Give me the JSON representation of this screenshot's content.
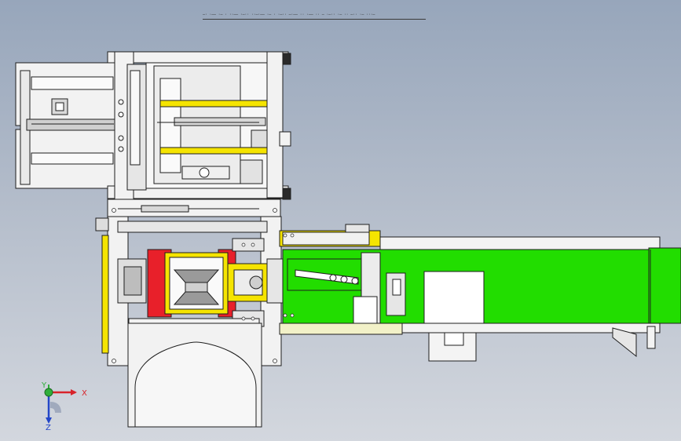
{
  "viewport": {
    "title_text": "—· ·—— ·— · ··—— ·—·· ··—·—— ·— · ·—·· —·—— ·· ·—— ·· — ·—·· ·— ·· —·· ·— ···—",
    "background_top": "#97a6bb",
    "background_bottom": "#d3d7de"
  },
  "model": {
    "description_hidden": false,
    "colors": {
      "frame": "#f2f2f2",
      "outline": "#1e1e1e",
      "yellow": "#f5e400",
      "green": "#22dd00",
      "red": "#e8202a",
      "gray": "#b9b9b9"
    }
  },
  "triad": {
    "x_label": "X",
    "y_label": "Y",
    "z_label": "Z",
    "x_color": "#d8232a",
    "y_color": "#2fae3a",
    "z_color": "#2346c8"
  },
  "icons": [
    "coordinate-triad-icon"
  ]
}
